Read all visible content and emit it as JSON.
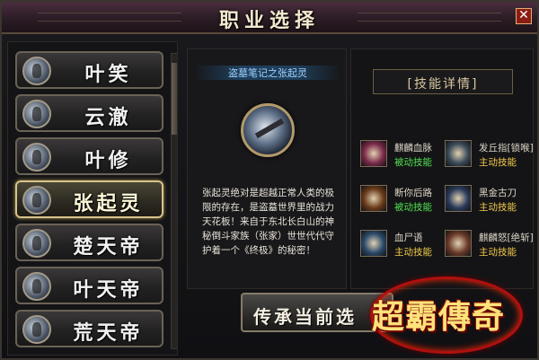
{
  "window": {
    "title": "职业选择",
    "close_icon": "close-icon"
  },
  "classes": [
    {
      "name": "叶笑",
      "selected": false
    },
    {
      "name": "云澈",
      "selected": false
    },
    {
      "name": "叶修",
      "selected": false
    },
    {
      "name": "张起灵",
      "selected": true
    },
    {
      "name": "楚天帝",
      "selected": false
    },
    {
      "name": "叶天帝",
      "selected": false
    },
    {
      "name": "荒天帝",
      "selected": false
    }
  ],
  "detail": {
    "subtitle": "盗墓笔记之张起灵",
    "description": "张起灵绝对是超越正常人类的极限的存在，是盗墓世界里的战力天花板！来自于东北长白山的神秘倒斗家族（张家）世世代代守护着一个《终极》的秘密！"
  },
  "skills": {
    "heading": "[技能详情]",
    "items": [
      {
        "name": "麒麟血脉",
        "type": "被动技能",
        "kind": "passive",
        "icon": "blood-icon",
        "color": "#7a2a4a"
      },
      {
        "name": "发丘指[锁喉]",
        "type": "主动技能",
        "kind": "active",
        "icon": "finger-icon",
        "color": "#3a4a5a"
      },
      {
        "name": "断你后路",
        "type": "被动技能",
        "kind": "passive",
        "icon": "claw-icon",
        "color": "#6a3a1a"
      },
      {
        "name": "黑金古刀",
        "type": "主动技能",
        "kind": "active",
        "icon": "blade-icon",
        "color": "#2a3a5a"
      },
      {
        "name": "血尸语",
        "type": "主动技能",
        "kind": "active",
        "icon": "corpse-icon",
        "color": "#2a4a6a"
      },
      {
        "name": "麒麟怒[绝斩]",
        "type": "主动技能",
        "kind": "active",
        "icon": "rage-icon",
        "color": "#6a3a2a"
      }
    ]
  },
  "inherit_button": {
    "label": "传承当前选"
  },
  "logo": {
    "text": "超霸傳奇"
  },
  "colors": {
    "accent": "#d8c38a",
    "passive": "#4fe04f",
    "active": "#f1c84b"
  }
}
